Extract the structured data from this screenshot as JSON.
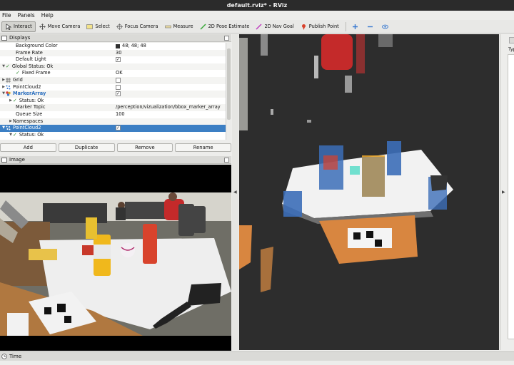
{
  "window": {
    "title": "default.rviz* - RViz"
  },
  "menu": [
    "File",
    "Panels",
    "Help"
  ],
  "toolbar": [
    {
      "label": "Interact",
      "icon": "interact-icon",
      "active": true
    },
    {
      "label": "Move Camera",
      "icon": "move-camera-icon"
    },
    {
      "label": "Select",
      "icon": "select-icon"
    },
    {
      "label": "Focus Camera",
      "icon": "focus-camera-icon"
    },
    {
      "label": "Measure",
      "icon": "measure-icon"
    },
    {
      "label": "2D Pose Estimate",
      "icon": "pose-estimate-icon"
    },
    {
      "label": "2D Nav Goal",
      "icon": "nav-goal-icon"
    },
    {
      "label": "Publish Point",
      "icon": "publish-point-icon"
    }
  ],
  "toolbar_extra_icons": [
    "plus-icon",
    "minus-icon",
    "eye-icon"
  ],
  "displays": {
    "title": "Displays",
    "rows": [
      {
        "label": "Background Color",
        "value": "48; 48; 48",
        "swatch": "#303030"
      },
      {
        "label": "Frame Rate",
        "value": "30"
      },
      {
        "label": "Default Light",
        "check": true
      },
      {
        "label": "Global Status: Ok",
        "status": true,
        "expander": "down"
      },
      {
        "label": "Fixed Frame",
        "value": "OK",
        "status": true
      },
      {
        "label": "Grid",
        "check": false,
        "expander": "right",
        "icon": "grid-icon"
      },
      {
        "label": "PointCloud2",
        "check": false,
        "expander": "right",
        "icon": "pointcloud-icon"
      },
      {
        "label": "MarkerArray",
        "check": true,
        "expander": "down",
        "icon": "marker-array-icon",
        "highlight": true
      },
      {
        "label": "Status: Ok",
        "status": true,
        "expander": "right"
      },
      {
        "label": "Marker Topic",
        "value": "/perception/vizualization/bbox_marker_array"
      },
      {
        "label": "Queue Size",
        "value": "100"
      },
      {
        "label": "Namespaces",
        "expander": "right"
      },
      {
        "label": "PointCloud2",
        "check": true,
        "expander": "down",
        "icon": "pointcloud-icon",
        "selected": true
      },
      {
        "label": "Status: Ok",
        "status": true,
        "expander": "down"
      }
    ],
    "buttons": [
      "Add",
      "Duplicate",
      "Remove",
      "Rename"
    ]
  },
  "image_panel": {
    "title": "Image"
  },
  "right_panel": {
    "label": "Typ"
  },
  "time_panel": {
    "title": "Time"
  },
  "colors": {
    "selection": "#3c7fc4",
    "ok": "#2a8a2a",
    "background_3d": "#2d2d2d"
  }
}
